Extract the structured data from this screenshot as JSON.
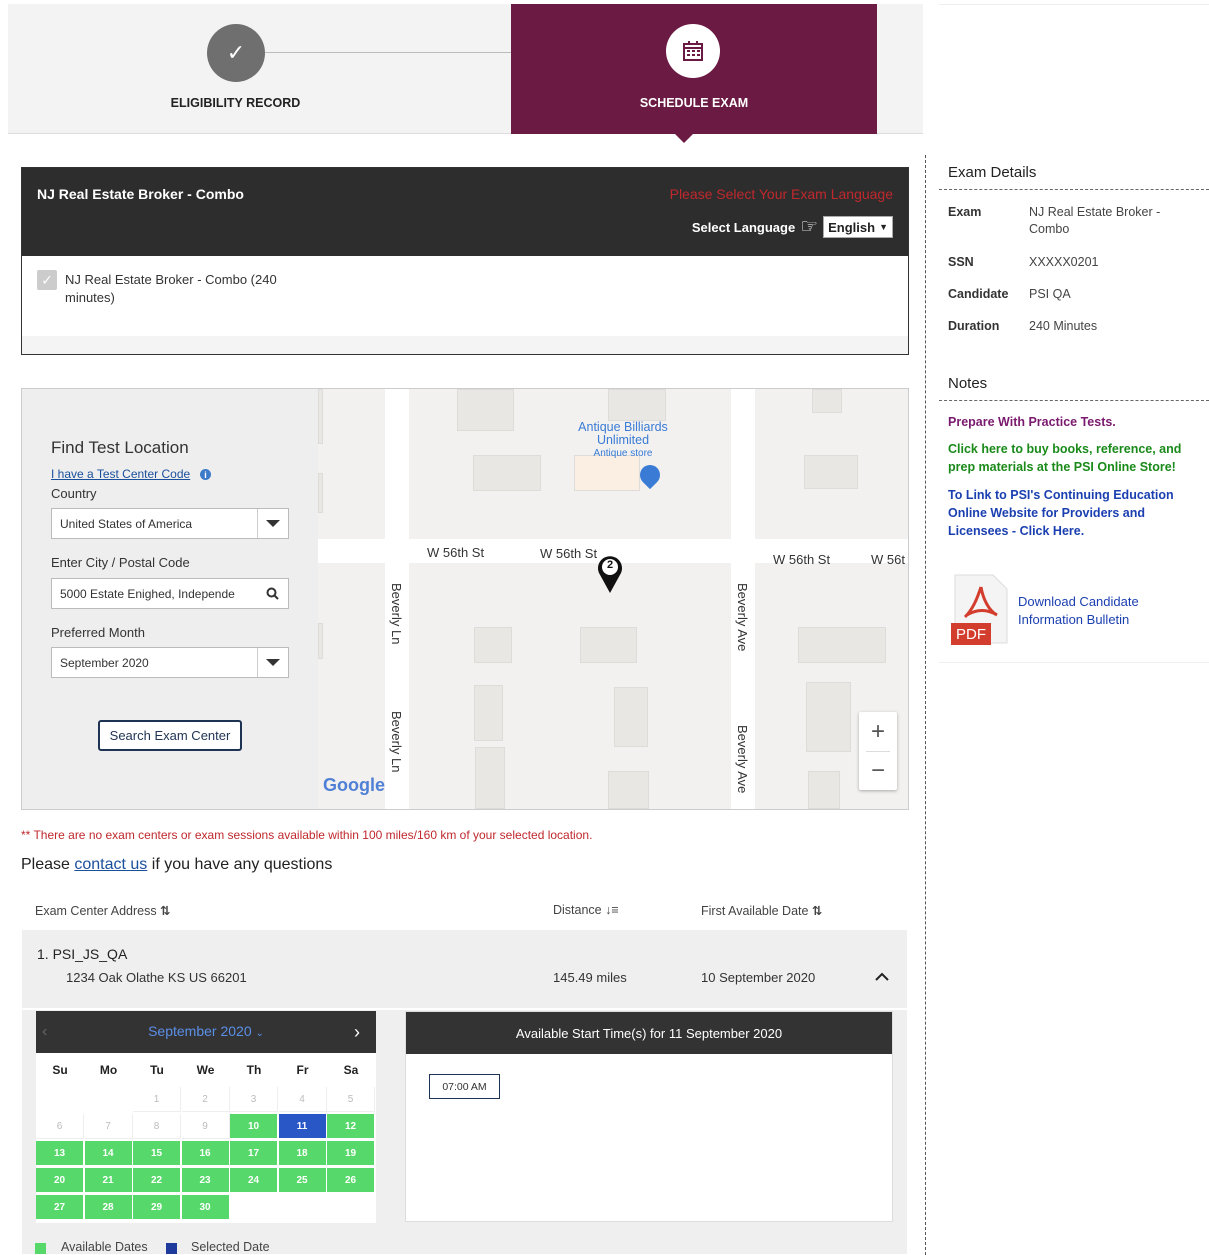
{
  "stepper": {
    "step1_icon": "✓",
    "step1_label": "ELIGIBILITY RECORD",
    "step2_label": "SCHEDULE EXAM",
    "step2_icon": "calendar-icon",
    "colors": {
      "active": "#6b1a43",
      "done": "#6f6f6f"
    }
  },
  "exam_panel": {
    "title": "NJ Real Estate Broker - Combo",
    "language_warning": "Please Select Your Exam Language",
    "language_label": "Select Language",
    "language_value": "English",
    "option_label": "NJ Real Estate Broker - Combo (240 minutes)"
  },
  "find": {
    "title": "Find Test Location",
    "center_code_link": "I have a Test Center Code",
    "country_label": "Country",
    "country_value": "United States of America",
    "city_label": "Enter City / Postal Code",
    "city_value": "5000 Estate Enighed, Independe",
    "month_label": "Preferred Month",
    "month_value": "September 2020",
    "search_button": "Search Exam Center"
  },
  "map": {
    "place_name_1": "Antique Billiards",
    "place_name_2": "Unlimited",
    "place_type": "Antique store",
    "streets": {
      "w56_a": "W 56th St",
      "w56_b": "W 56th St",
      "w56_c": "W 56th St",
      "w56_d": "W 56t",
      "beverly_ln": "Beverly Ln",
      "beverly_ave": "Beverly Ave"
    },
    "marker_number": "2",
    "zoom_in": "+",
    "zoom_out": "−",
    "logo": "Google"
  },
  "messages": {
    "no_centers": "** There are no exam centers or exam sessions available within 100 miles/160 km of your selected location.",
    "contact_prefix": "Please ",
    "contact_link": "contact us",
    "contact_suffix": " if you have any questions"
  },
  "results": {
    "headers": {
      "address": "Exam Center Address",
      "distance": "Distance",
      "first_date": "First Available Date"
    },
    "rows": [
      {
        "index": "1.",
        "name": "PSI_JS_QA",
        "address": "1234 Oak Olathe KS US 66201",
        "distance": "145.49 miles",
        "first_date": "10 September 2020"
      }
    ]
  },
  "calendar": {
    "month_label": "September 2020",
    "weekdays": [
      "Su",
      "Mo",
      "Tu",
      "We",
      "Th",
      "Fr",
      "Sa"
    ],
    "weeks": [
      [
        "",
        "",
        "1",
        "2",
        "3",
        "4",
        "5"
      ],
      [
        "6",
        "7",
        "8",
        "9",
        "10",
        "11",
        "12"
      ],
      [
        "13",
        "14",
        "15",
        "16",
        "17",
        "18",
        "19"
      ],
      [
        "20",
        "21",
        "22",
        "23",
        "24",
        "25",
        "26"
      ],
      [
        "27",
        "28",
        "29",
        "30",
        "",
        "",
        ""
      ]
    ],
    "available_from": 10,
    "available_to": 30,
    "selected": "11",
    "colors": {
      "available": "#57d86a",
      "selected": "#2a57c6"
    },
    "legend_available": "Available Dates",
    "legend_selected": "Selected Date"
  },
  "times": {
    "title": "Available Start Time(s) for 11 September 2020",
    "slots": [
      "07:00 AM"
    ]
  },
  "sidebar": {
    "details_title": "Exam Details",
    "details": [
      {
        "label": "Exam",
        "value": "NJ Real Estate Broker - Combo"
      },
      {
        "label": "SSN",
        "value": "XXXXX0201"
      },
      {
        "label": "Candidate",
        "value": "PSI QA"
      },
      {
        "label": "Duration",
        "value": "240 Minutes"
      }
    ],
    "notes_title": "Notes",
    "notes": [
      {
        "text": "Prepare With Practice Tests.",
        "color": "#7a1a6e"
      },
      {
        "text": "Click here to buy books, reference, and prep materials at the PSI Online Store!",
        "color": "#1a8a1a"
      },
      {
        "text": "To Link to PSI's Continuing Education Online Website for Providers and Licensees - Click Here.",
        "color": "#1a3fb0"
      }
    ],
    "pdf_label": "PDF",
    "download_link": "Download Candidate Information Bulletin"
  }
}
